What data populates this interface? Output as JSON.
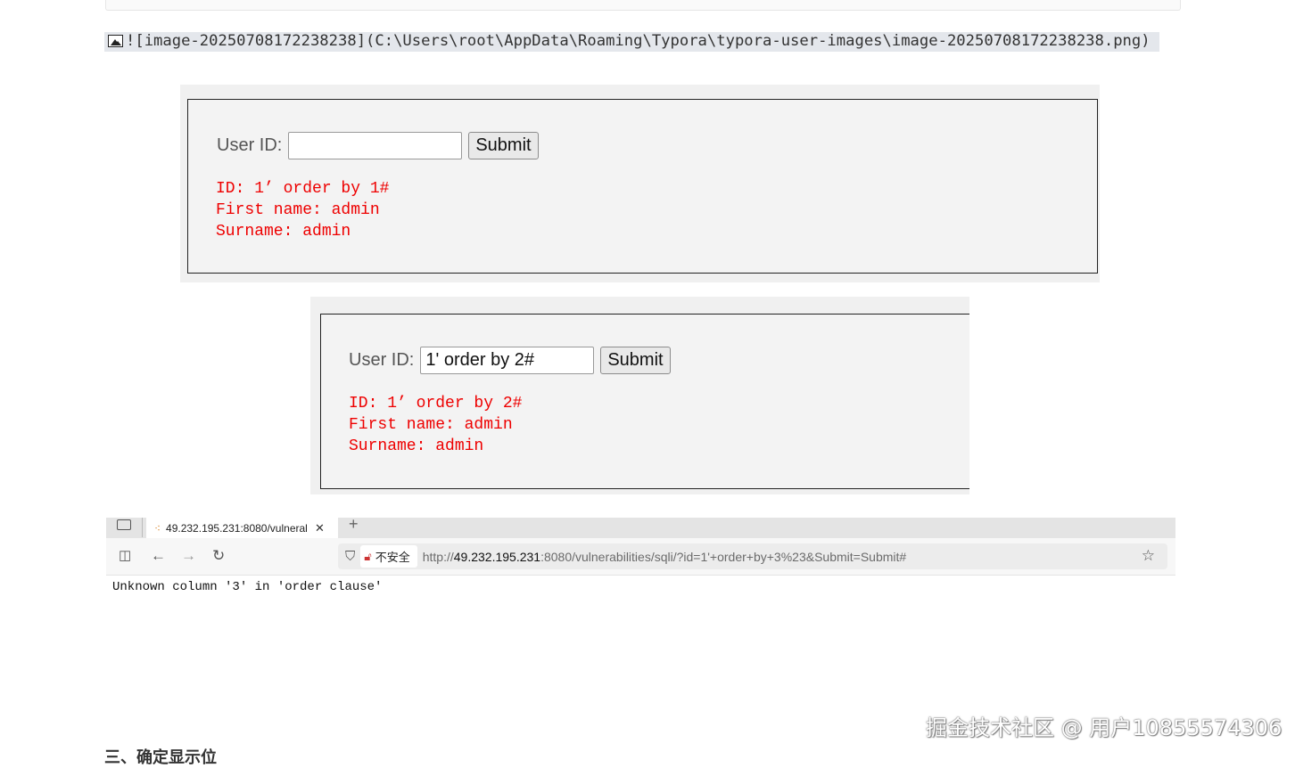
{
  "markdown_image": {
    "text": "![image-20250708172238238](C:\\Users\\root\\AppData\\Roaming\\Typora\\typora-user-images\\image-20250708172238238.png)"
  },
  "screenshot1": {
    "label": "User ID:",
    "input_value": "",
    "submit": "Submit",
    "result": [
      "ID: 1’ order by 1#",
      "First name: admin",
      "Surname: admin"
    ]
  },
  "screenshot2": {
    "label": "User ID:",
    "input_value": "1' order by 2#",
    "submit": "Submit",
    "result": [
      "ID: 1’ order by 2#",
      "First name: admin",
      "Surname: admin"
    ]
  },
  "browser": {
    "tab_title": "49.232.195.231:8080/vulneral",
    "not_secure": "不安全",
    "url_scheme": "http://",
    "url_host": "49.232.195.231",
    "url_rest": ":8080/vulnerabilities/sqli/?id=1'+order+by+3%23&Submit=Submit#",
    "error": "Unknown column '3' in 'order clause'"
  },
  "watermark": "掘金技术社区 @ 用户10855574306",
  "next_heading": "三、确定显示位"
}
